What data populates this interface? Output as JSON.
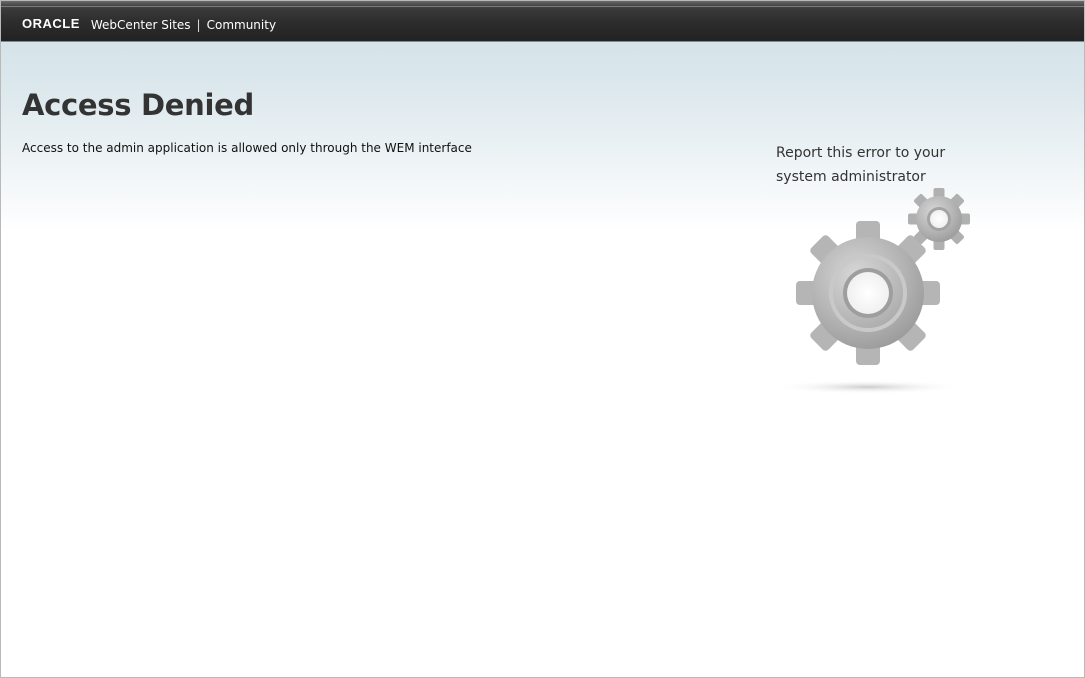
{
  "header": {
    "logo": "ORACLE",
    "product": "WebCenter Sites",
    "separator": "|",
    "site": "Community"
  },
  "main": {
    "title": "Access Denied",
    "message": "Access to the admin application is allowed only through the WEM interface",
    "report": "Report this error to your system administrator"
  },
  "icons": {
    "illustration": "gears-icon"
  }
}
